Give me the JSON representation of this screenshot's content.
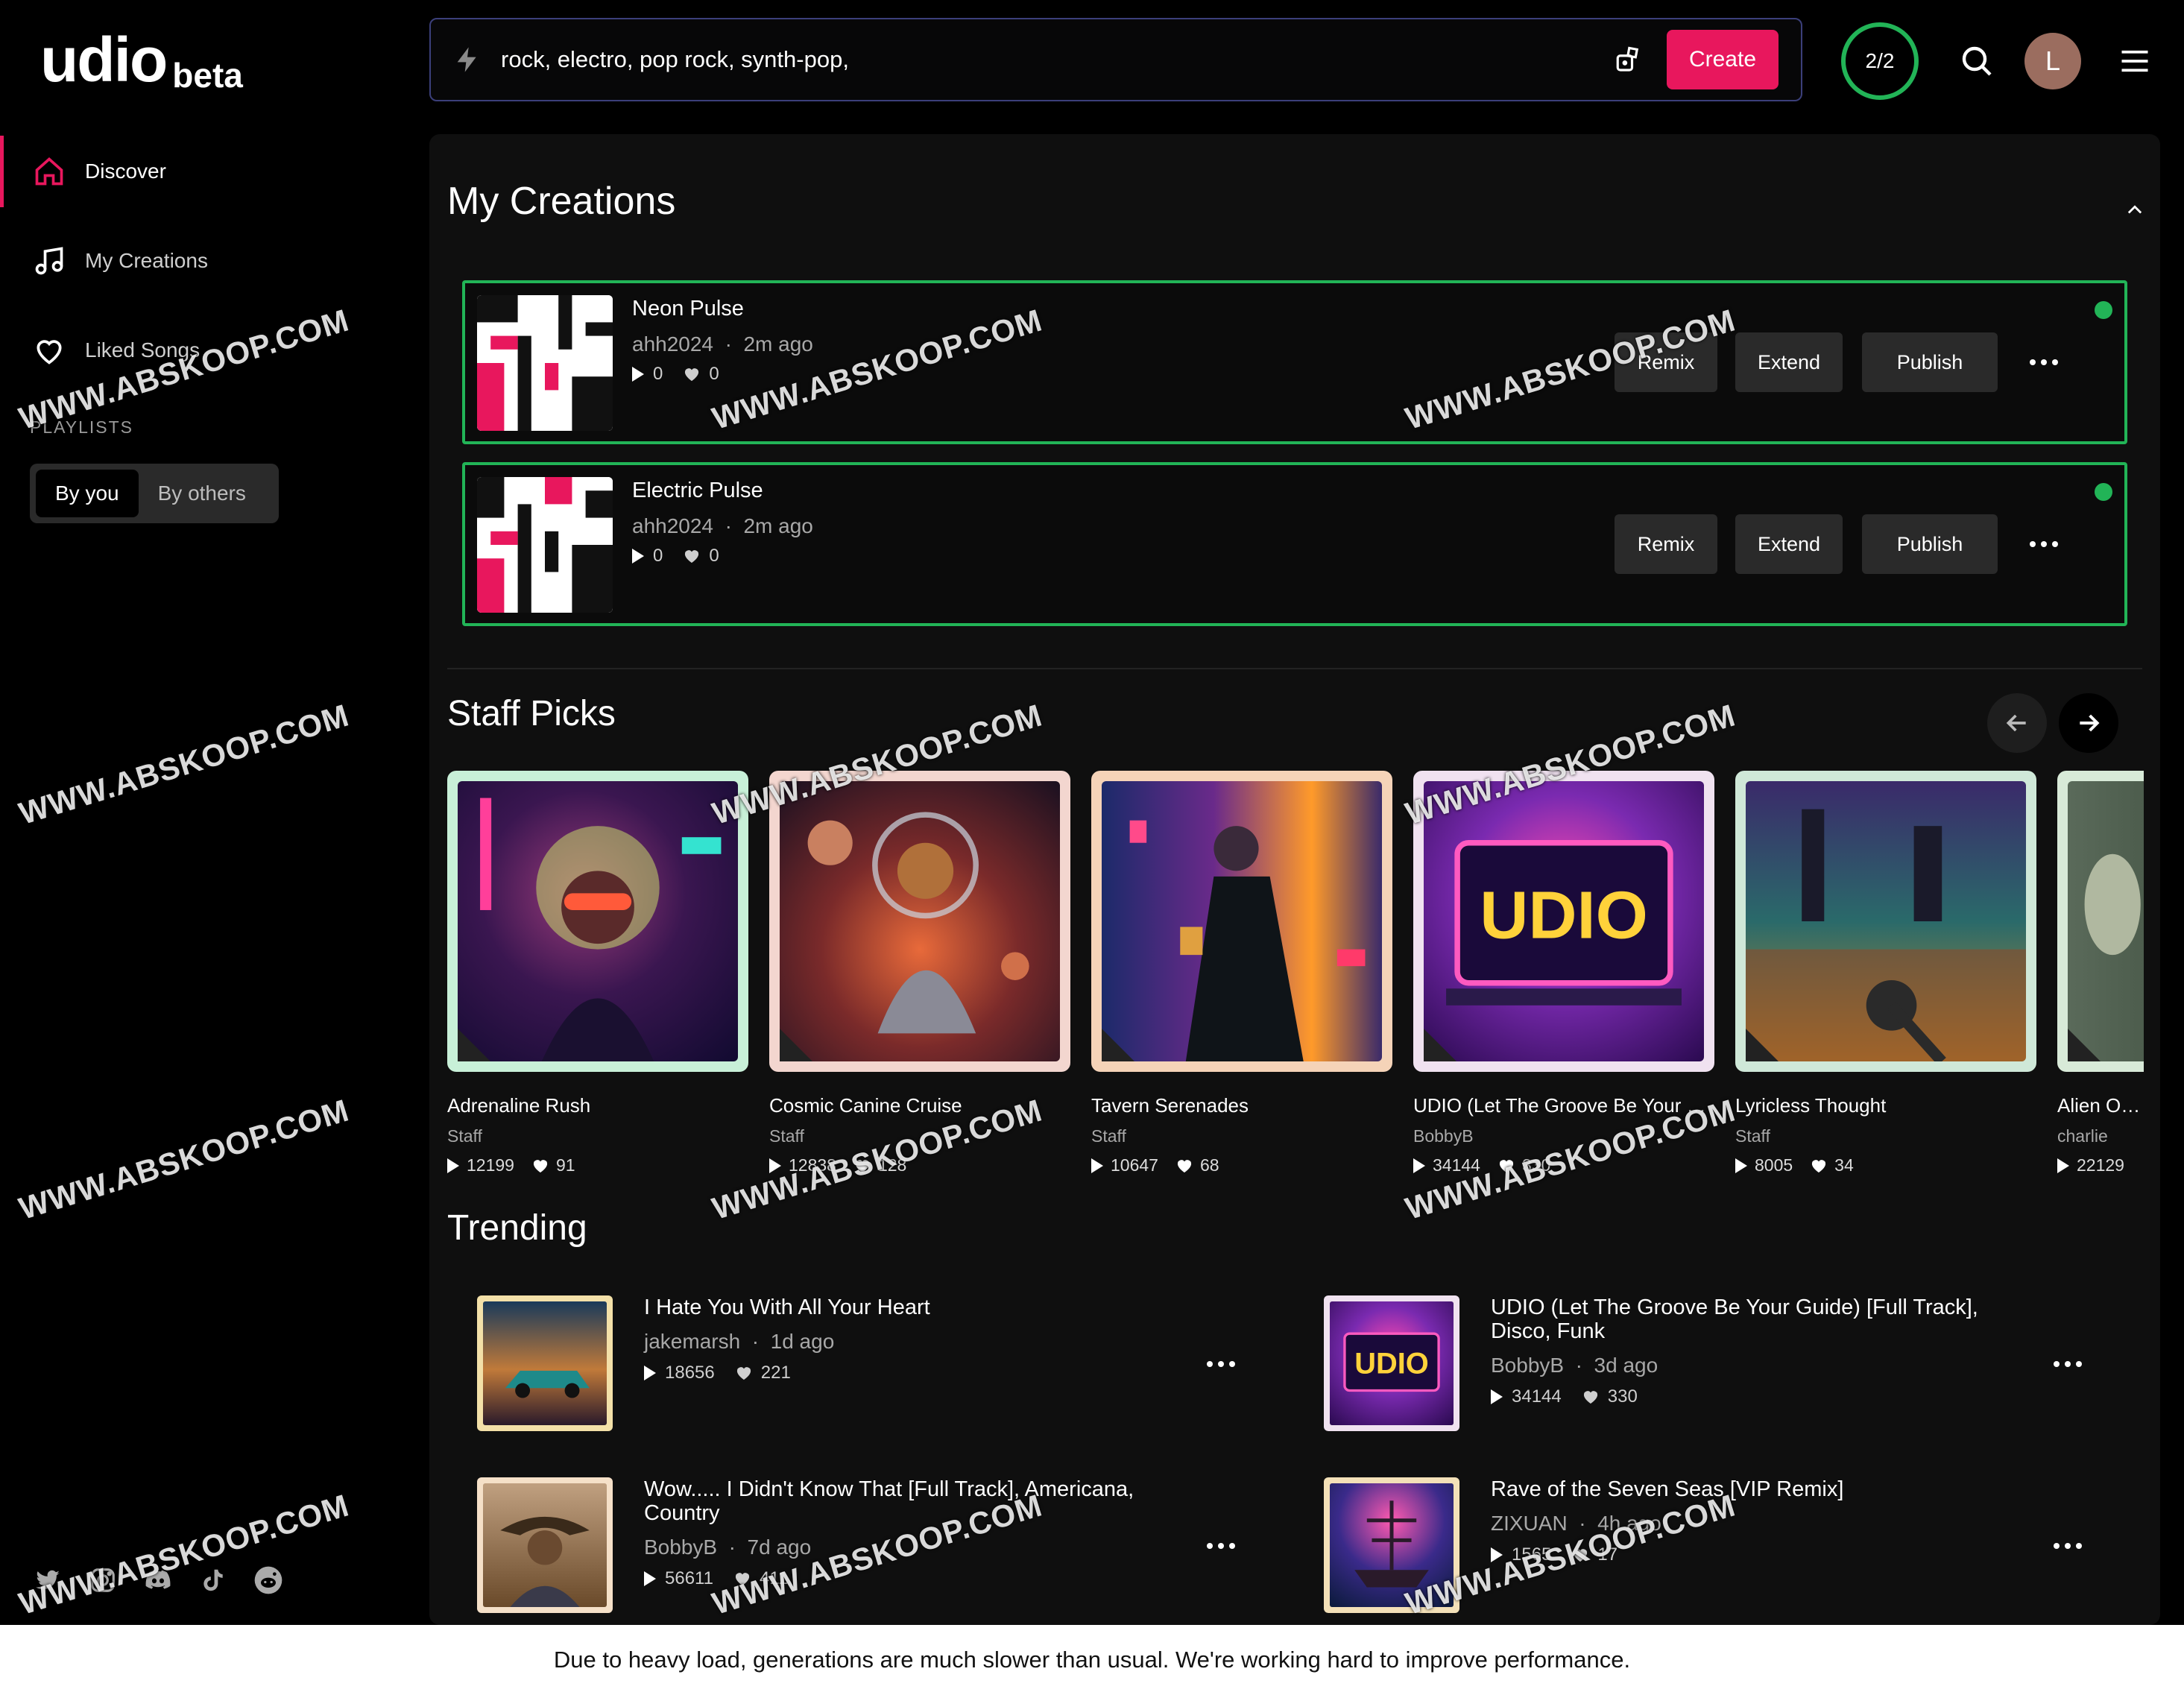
{
  "brand": {
    "name": "udio",
    "tag": "beta",
    "accent": "#e8175d",
    "success": "#22b457"
  },
  "header": {
    "prompt": "rock, electro, pop rock, synth-pop,",
    "create_label": "Create",
    "credits": "2/2",
    "avatar_letter": "L",
    "icons": [
      "bolt-icon",
      "dice-icon",
      "search-icon",
      "menu-icon"
    ]
  },
  "sidebar": {
    "items": [
      {
        "label": "Discover",
        "icon": "home-icon",
        "active": true
      },
      {
        "label": "My Creations",
        "icon": "music-note-icon",
        "active": false
      },
      {
        "label": "Liked Songs",
        "icon": "heart-icon",
        "active": false
      }
    ],
    "playlists_label": "PLAYLISTS",
    "playlist_tabs": [
      "By you",
      "By others"
    ],
    "socials": [
      "twitter-icon",
      "instagram-icon",
      "discord-icon",
      "tiktok-icon",
      "reddit-icon"
    ]
  },
  "my_creations": {
    "title": "My Creations",
    "items": [
      {
        "title": "Neon Pulse",
        "author": "ahh2024",
        "age": "2m ago",
        "plays": "0",
        "likes": "0"
      },
      {
        "title": "Electric Pulse",
        "author": "ahh2024",
        "age": "2m ago",
        "plays": "0",
        "likes": "0"
      }
    ],
    "actions": {
      "remix": "Remix",
      "extend": "Extend",
      "publish": "Publish"
    }
  },
  "staff_picks": {
    "title": "Staff Picks",
    "items": [
      {
        "title": "Adrenaline Rush",
        "author": "Staff",
        "plays": "12199",
        "likes": "91"
      },
      {
        "title": "Cosmic Canine Cruise",
        "author": "Staff",
        "plays": "12838",
        "likes": "128"
      },
      {
        "title": "Tavern Serenades",
        "author": "Staff",
        "plays": "10647",
        "likes": "68"
      },
      {
        "title": "UDIO (Let The Groove Be Your Guide)",
        "author": "BobbyB",
        "plays": "34144",
        "likes": "330"
      },
      {
        "title": "Lyricless Thought",
        "author": "Staff",
        "plays": "8005",
        "likes": "34"
      },
      {
        "title": "Alien Ocean",
        "author": "charlie",
        "plays": "22129",
        "likes": ""
      }
    ]
  },
  "trending": {
    "title": "Trending",
    "items": [
      {
        "title": "I Hate You With All Your Heart",
        "author": "jakemarsh",
        "age": "1d ago",
        "plays": "18656",
        "likes": "221"
      },
      {
        "title": "UDIO (Let The Groove Be Your Guide) [Full Track], Disco, Funk",
        "author": "BobbyB",
        "age": "3d ago",
        "plays": "34144",
        "likes": "330"
      },
      {
        "title": "Wow..... I Didn't Know That [Full Track], Americana, Country",
        "author": "BobbyB",
        "age": "7d ago",
        "plays": "56611",
        "likes": "411"
      },
      {
        "title": "Rave of the Seven Seas [VIP Remix]",
        "author": "ZIXUAN",
        "age": "4h ago",
        "plays": "1565",
        "likes": "17"
      }
    ]
  },
  "banner": "Due to heavy load, generations are much slower than usual. We're working hard to improve performance.",
  "watermark": "WWW.ABSKOOP.COM"
}
